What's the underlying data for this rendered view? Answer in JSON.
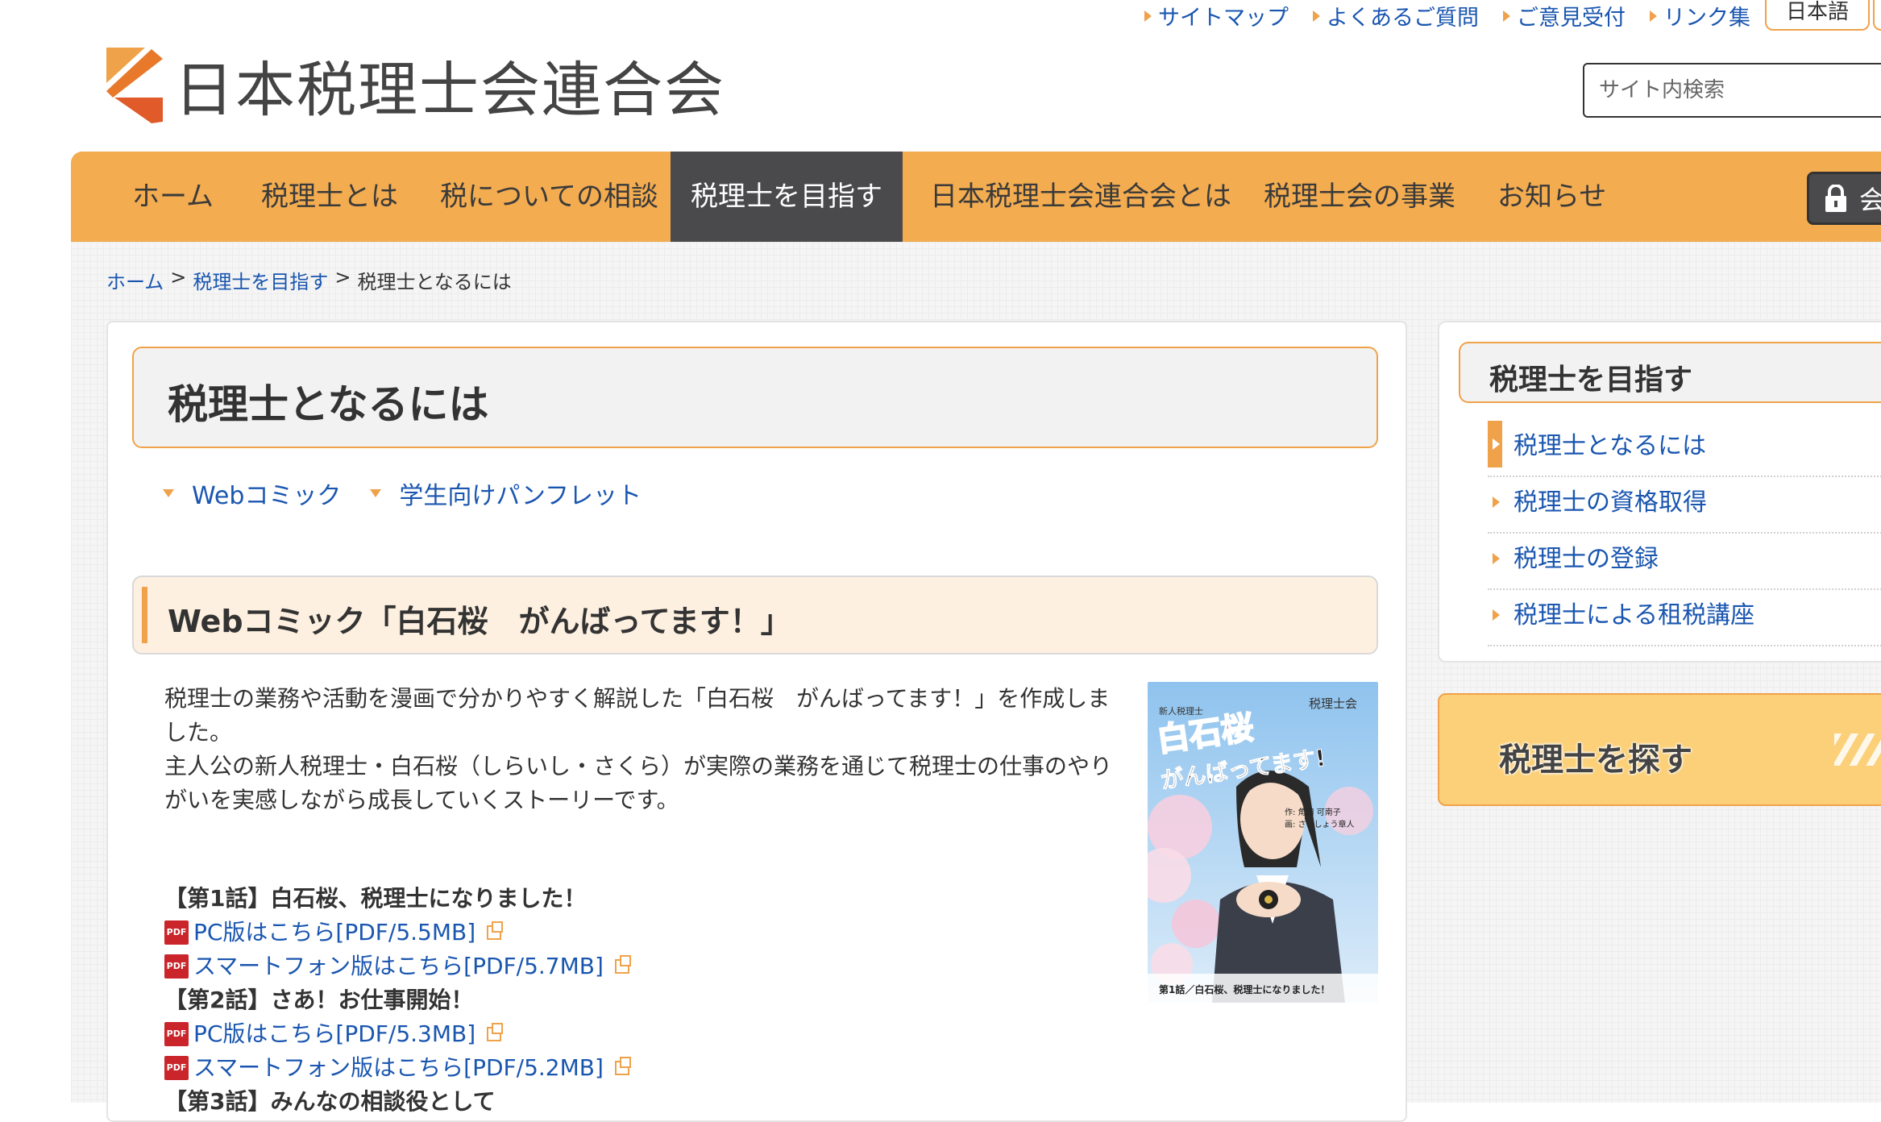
{
  "header": {
    "org_name": "日本税理士会連合会",
    "util_links": [
      "サイトマップ",
      "よくあるご質問",
      "ご意見受付",
      "リンク集"
    ],
    "language": "日本語",
    "search_placeholder": "サイト内検索"
  },
  "nav": {
    "items": [
      "ホーム",
      "税理士とは",
      "税についての相談",
      "税理士を目指す",
      "日本税理士会連合会とは",
      "税理士会の事業",
      "お知らせ"
    ],
    "active": "税理士を目指す",
    "member_label": "会"
  },
  "breadcrumb": {
    "home": "ホーム",
    "sep1": ">",
    "parent": "税理士を目指す",
    "sep2": ">",
    "current": "税理士となるには"
  },
  "main": {
    "title": "税理士となるには",
    "anchors": [
      "Webコミック",
      "学生向けパンフレット"
    ],
    "section_title": "Webコミック「白石桜　がんばってます！」",
    "para1": "税理士の業務や活動を漫画で分かりやすく解説した「白石桜　がんばってます！」を作成しました。",
    "para2": "主人公の新人税理士・白石桜（しらいし・さくら）が実際の業務を通じて税理士の仕事のやりがいを実感しながら成長していくストーリーです。",
    "episodes": [
      {
        "title": "【第1話】白石桜、税理士になりました！",
        "pc": "PC版はこちら[PDF/5.5MB]",
        "sp": "スマートフォン版はこちら[PDF/5.7MB]"
      },
      {
        "title": "【第2話】さあ！お仕事開始！",
        "pc": "PC版はこちら[PDF/5.3MB]",
        "sp": "スマートフォン版はこちら[PDF/5.2MB]"
      }
    ],
    "episode3_partial": "【第3話】みんなの相談役として",
    "pdf_badge": "PDF",
    "comic_cover": {
      "publisher": "税理士会",
      "tag": "新人税理士",
      "title_main": "白石桜",
      "title_sub": "がんばってます!",
      "author_line1": "作: 角田 可南子",
      "author_line2": "画: さいしょう章人",
      "caption": "第1話／白石桜、税理士になりました！"
    }
  },
  "sidebar": {
    "title": "税理士を目指す",
    "items": [
      "税理士となるには",
      "税理士の資格取得",
      "税理士の登録",
      "税理士による租税講座"
    ],
    "banner": "税理士を探す"
  },
  "colors": {
    "accent": "#f3ac50",
    "link": "#1a56b0",
    "nav_active": "#4a4a4d"
  }
}
